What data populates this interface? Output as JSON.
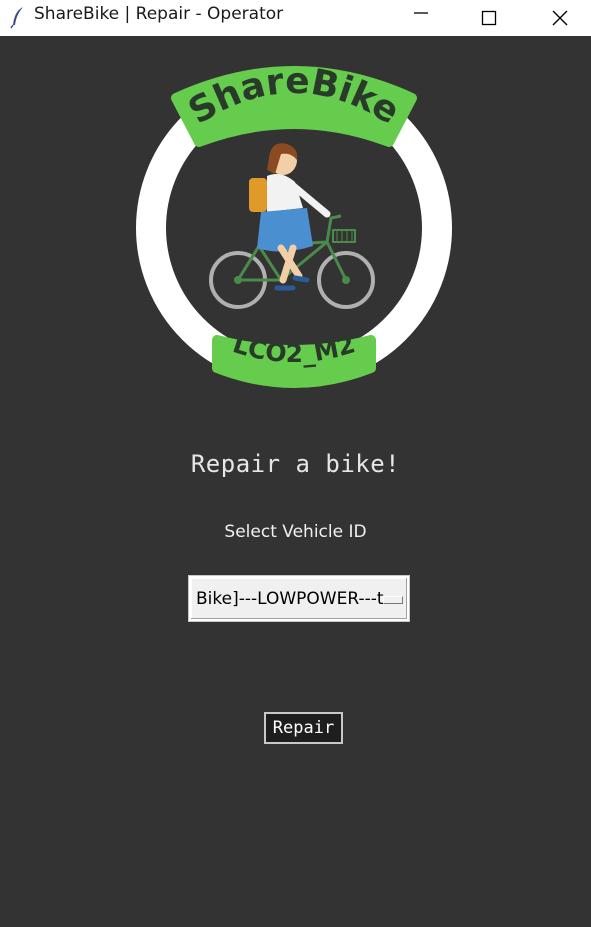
{
  "window": {
    "title": "ShareBike | Repair - Operator",
    "controls": [
      "minimize-icon",
      "maximize-icon",
      "close-icon"
    ]
  },
  "logo": {
    "top_text": "ShareBike",
    "bottom_text": "LCO2_M2",
    "colors": {
      "banner": "#66cc4d",
      "ring": "#ffffff",
      "text": "#2a3a2a"
    }
  },
  "heading": "Repair a bike!",
  "vehicle": {
    "label": "Select Vehicle ID",
    "selected_value": "Bike]---LOWPOWER---t"
  },
  "repair_button": {
    "label": "Repair"
  },
  "colors": {
    "background": "#333333",
    "titlebar": "#ffffff"
  }
}
